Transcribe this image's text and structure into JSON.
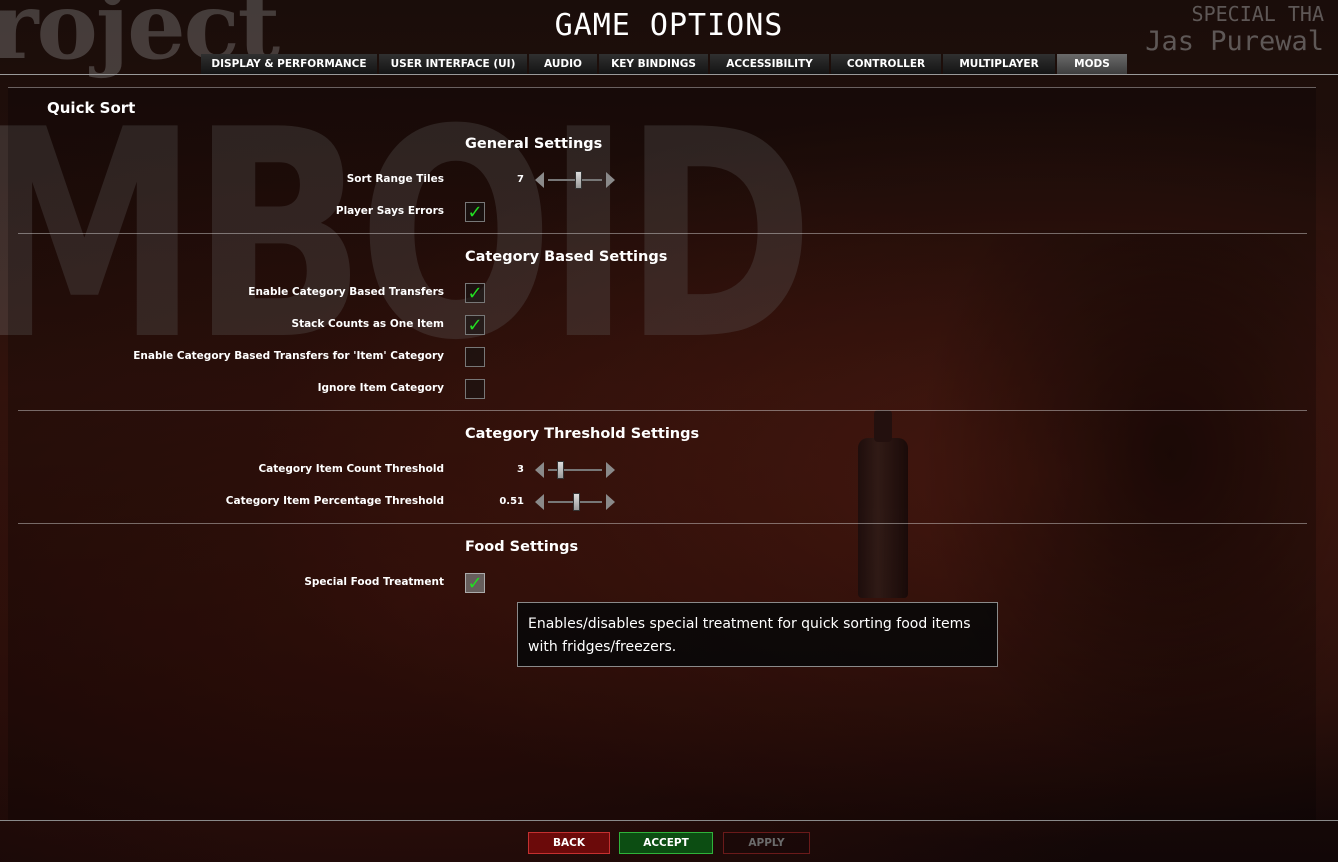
{
  "window": {
    "title": "GAME OPTIONS"
  },
  "background": {
    "logo_top": "roject",
    "logo_big": "MBOID",
    "credits_line1": "SPECIAL THA",
    "credits_line2": "Jas Purewal"
  },
  "tabs": [
    {
      "label": "DISPLAY & PERFORMANCE",
      "active": false
    },
    {
      "label": "USER INTERFACE (UI)",
      "active": false
    },
    {
      "label": "AUDIO",
      "active": false
    },
    {
      "label": "KEY BINDINGS",
      "active": false
    },
    {
      "label": "ACCESSIBILITY",
      "active": false
    },
    {
      "label": "CONTROLLER",
      "active": false
    },
    {
      "label": "MULTIPLAYER",
      "active": false
    },
    {
      "label": "MODS",
      "active": true
    }
  ],
  "mod": {
    "title": "Quick Sort"
  },
  "general": {
    "title": "General Settings",
    "sort_range": {
      "label": "Sort Range Tiles",
      "value": "7",
      "fraction": 0.55
    },
    "player_errors": {
      "label": "Player Says Errors",
      "checked": true
    }
  },
  "category": {
    "title": "Category Based Settings",
    "enable_transfers": {
      "label": "Enable Category Based Transfers",
      "checked": true
    },
    "stack_counts": {
      "label": "Stack Counts as One Item",
      "checked": true
    },
    "item_category": {
      "label": "Enable Category Based Transfers for 'Item' Category",
      "checked": false
    },
    "ignore_item": {
      "label": "Ignore Item Category",
      "checked": false
    }
  },
  "threshold": {
    "title": "Category Threshold Settings",
    "count": {
      "label": "Category Item Count Threshold",
      "value": "3",
      "fraction": 0.22
    },
    "percentage": {
      "label": "Category Item Percentage Threshold",
      "value": "0.51",
      "fraction": 0.51
    }
  },
  "food": {
    "title": "Food Settings",
    "special": {
      "label": "Special Food Treatment",
      "checked": true
    }
  },
  "tooltip": {
    "text": "Enables/disables special treatment for quick sorting food items with fridges/freezers."
  },
  "buttons": {
    "back": "BACK",
    "accept": "ACCEPT",
    "apply": "APPLY"
  },
  "check_glyph": "✓",
  "colors": {
    "check": "#22dd22",
    "back": "#6b0a0a",
    "accept": "#0c4d12"
  }
}
